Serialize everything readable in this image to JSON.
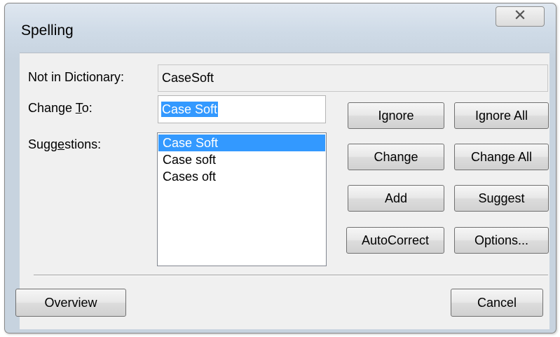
{
  "window": {
    "title": "Spelling",
    "close_icon": "close-x-icon"
  },
  "fields": {
    "not_in_dictionary_label": "Not in Dictionary:",
    "not_in_dictionary_value": "CaseSoft",
    "change_to_label_pre": "Change ",
    "change_to_label_mnemonic": "T",
    "change_to_label_post": "o:",
    "change_to_value": "Case Soft",
    "suggestions_label_pre": "Sugg",
    "suggestions_label_mnemonic": "e",
    "suggestions_label_post": "stions:"
  },
  "suggestions": [
    {
      "text": "Case Soft",
      "selected": true
    },
    {
      "text": "Case soft",
      "selected": false
    },
    {
      "text": "Cases oft",
      "selected": false
    }
  ],
  "buttons": {
    "ignore": "Ignore",
    "ignore_all": "Ignore All",
    "change": "Change",
    "change_all": "Change All",
    "add": "Add",
    "suggest": "Suggest",
    "autocorrect": "AutoCorrect",
    "options": "Options...",
    "overview": "Overview",
    "cancel": "Cancel"
  },
  "colors": {
    "selection": "#3399ff",
    "title_gradient_top": "#dfe7f0",
    "dialog_bg": "#f0f0f0"
  }
}
